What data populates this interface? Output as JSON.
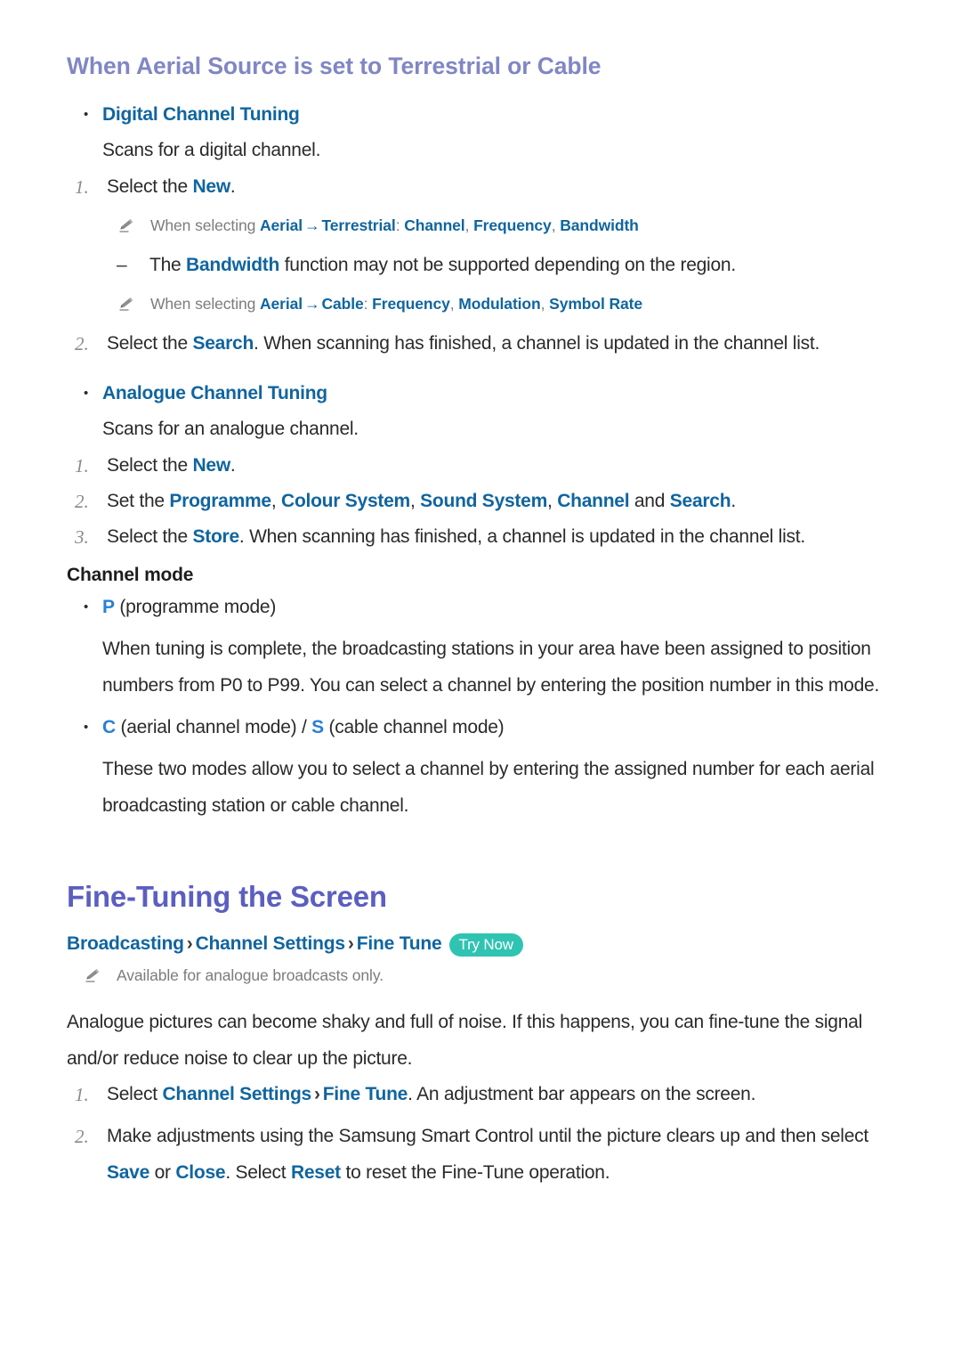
{
  "section1": {
    "heading": "When Aerial Source is set to Terrestrial or Cable",
    "items": [
      {
        "bullet_label": "Digital Channel Tuning",
        "description": "Scans for a digital channel."
      },
      {
        "bullet_label": "Analogue Channel Tuning",
        "description": "Scans for an analogue channel."
      }
    ],
    "digital_steps": [
      {
        "number": "1.",
        "prefix": "Select the ",
        "link": "New",
        "suffix": "."
      },
      {
        "number": "2.",
        "prefix": "Select the ",
        "link": "Search",
        "suffix": ". When scanning has finished, a channel is updated in the channel list."
      }
    ],
    "note_terrestrial": {
      "lead": "When selecting ",
      "term1": "Aerial",
      "arrow": "→",
      "term2": "Terrestrial",
      "colon": ":",
      "values": [
        "Channel",
        "Frequency",
        "Bandwidth"
      ]
    },
    "dash_bandwidth": {
      "prefix": "The ",
      "link": "Bandwidth",
      "suffix": " function may not be supported depending on the region."
    },
    "note_cable": {
      "lead": "When selecting ",
      "term1": "Aerial",
      "arrow": "→",
      "term2": "Cable",
      "colon": ":",
      "values": [
        "Frequency",
        "Modulation",
        "Symbol Rate"
      ]
    },
    "analogue_steps": [
      {
        "number": "1.",
        "text_before": "Select the ",
        "link": "New",
        "text_after": "."
      },
      {
        "number": "2.",
        "text_before": "Set the ",
        "links": [
          "Programme",
          "Colour System",
          "Sound System",
          "Channel"
        ],
        "conjunction": " and ",
        "last_link": "Search",
        "text_after": "."
      },
      {
        "number": "3.",
        "text_before": "Select the ",
        "link": "Store",
        "text_after": ". When scanning has finished, a channel is updated in the channel list."
      }
    ],
    "channel_mode": {
      "heading": "Channel mode",
      "entries": [
        {
          "code": "P",
          "label": " (programme mode)",
          "paragraph": "When tuning is complete, the broadcasting stations in your area have been assigned to position numbers from P0 to P99. You can select a channel by entering the position number in this mode."
        },
        {
          "code_a": "C",
          "label_a": " (aerial channel mode) / ",
          "code_b": "S",
          "label_b": " (cable channel mode)",
          "paragraph": "These two modes allow you to select a channel by entering the assigned number for each aerial broadcasting station or cable channel."
        }
      ]
    }
  },
  "section2": {
    "heading": "Fine-Tuning the Screen",
    "breadcrumb": {
      "items": [
        "Broadcasting",
        "Channel Settings",
        "Fine Tune"
      ],
      "separator": "›",
      "badge": "Try Now"
    },
    "note": "Available for analogue broadcasts only.",
    "intro": "Analogue pictures can become shaky and full of noise. If this happens, you can fine-tune the signal and/or reduce noise to clear up the picture.",
    "steps": [
      {
        "number": "1.",
        "prefix": "Select ",
        "link1": "Channel Settings",
        "separator": "›",
        "link2": "Fine Tune",
        "suffix": ". An adjustment bar appears on the screen."
      },
      {
        "number": "2.",
        "prefix": "Make adjustments using the Samsung Smart Control until the picture clears up and then select ",
        "link1": "Save",
        "mid1": " or ",
        "link2": "Close",
        "mid2": ". Select ",
        "link3": "Reset",
        "suffix": " to reset the Fine-Tune operation."
      }
    ]
  },
  "colors": {
    "section_heading": "#8186c4",
    "chapter_heading": "#5b5fc0",
    "link_blue": "#10659f",
    "bright_blue": "#2b7fd4",
    "note_gray": "#7c7c7c",
    "badge_teal": "#2fc4b2",
    "body": "#2a2a2a"
  }
}
